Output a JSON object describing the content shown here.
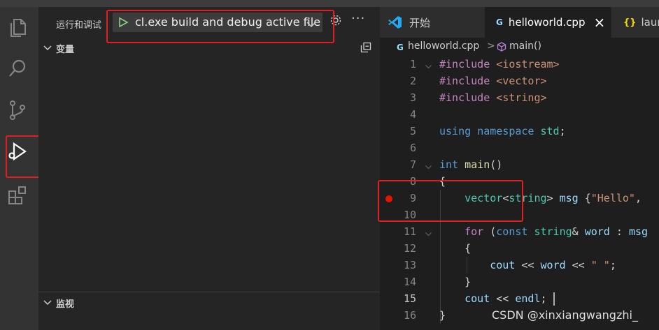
{
  "activity_bar": {
    "icons": [
      "explorer-icon",
      "search-icon",
      "source-control-icon",
      "run-debug-icon",
      "extensions-icon"
    ]
  },
  "sidebar": {
    "title": "运行和调试",
    "launch_config": "cl.exe build and debug active file",
    "variables_label": "变量",
    "watch_label": "监视"
  },
  "tabs": [
    {
      "label": "开始",
      "active": false
    },
    {
      "label": "helloworld.cpp",
      "active": true,
      "close": "×"
    },
    {
      "label": "laun",
      "active": false,
      "icon_text": "{}"
    }
  ],
  "breadcrumb": {
    "file": "helloworld.cpp",
    "separator": ">",
    "symbol": "main()"
  },
  "code": {
    "breakpoint_line": 9,
    "current_line": 15,
    "lines": [
      {
        "n": "1",
        "text": "#include <iostream>"
      },
      {
        "n": "2",
        "text": "#include <vector>"
      },
      {
        "n": "3",
        "text": "#include <string>"
      },
      {
        "n": "4",
        "text": ""
      },
      {
        "n": "5",
        "text": "using namespace std;"
      },
      {
        "n": "6",
        "text": ""
      },
      {
        "n": "7",
        "text": "int main()"
      },
      {
        "n": "8",
        "text": "{"
      },
      {
        "n": "9",
        "text": "    vector<string> msg {\"Hello\","
      },
      {
        "n": "10",
        "text": ""
      },
      {
        "n": "11",
        "text": "    for (const string& word : msg"
      },
      {
        "n": "12",
        "text": "    {"
      },
      {
        "n": "13",
        "text": "        cout << word << \" \";"
      },
      {
        "n": "14",
        "text": "    }"
      },
      {
        "n": "15",
        "text": "    cout << endl;"
      },
      {
        "n": "16",
        "text": "}"
      }
    ]
  },
  "watermark": "CSDN @xinxiangwangzhi_",
  "colors": {
    "breakpoint": "#e51400",
    "highlight_box": "#e02020",
    "play_icon": "#89d185",
    "vscode_blue": "#23a9f2"
  }
}
